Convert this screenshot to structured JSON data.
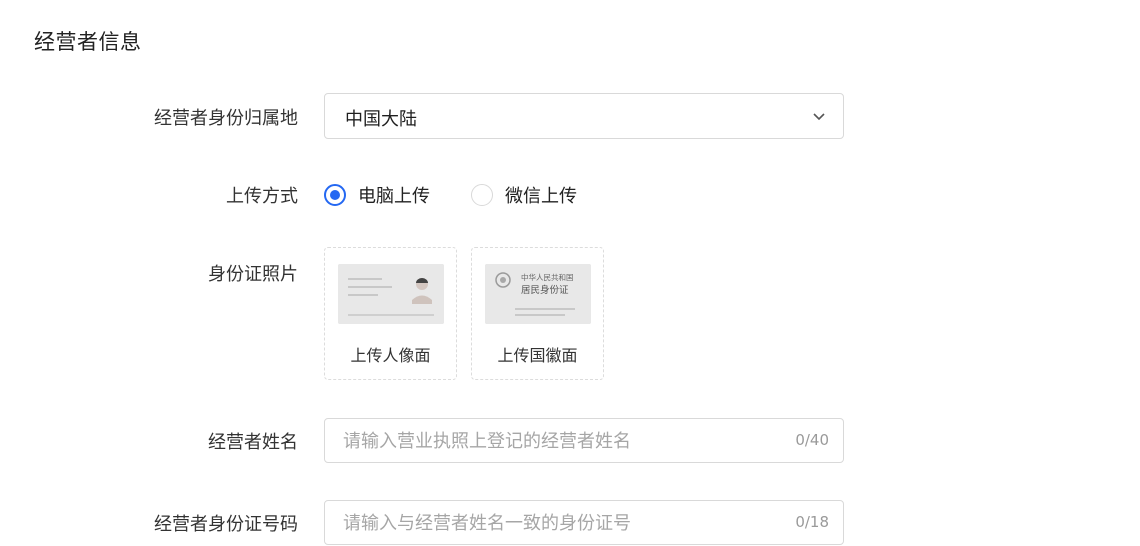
{
  "section": {
    "title": "经营者信息"
  },
  "fields": {
    "region": {
      "label": "经营者身份归属地",
      "value": "中国大陆",
      "icon": "chevron-down-icon"
    },
    "upload_method": {
      "label": "上传方式",
      "options": [
        {
          "label": "电脑上传",
          "checked": true
        },
        {
          "label": "微信上传",
          "checked": false
        }
      ],
      "accent": "#2468f2"
    },
    "id_photo": {
      "label": "身份证照片",
      "front": {
        "caption": "上传人像面"
      },
      "back": {
        "caption": "上传国徽面",
        "card_line1": "中华人民共和国",
        "card_line2": "居民身份证"
      }
    },
    "name": {
      "label": "经营者姓名",
      "placeholder": "请输入营业执照上登记的经营者姓名",
      "counter": "0/40"
    },
    "id_number": {
      "label": "经营者身份证号码",
      "placeholder": "请输入与经营者姓名一致的身份证号",
      "counter": "0/18"
    }
  }
}
